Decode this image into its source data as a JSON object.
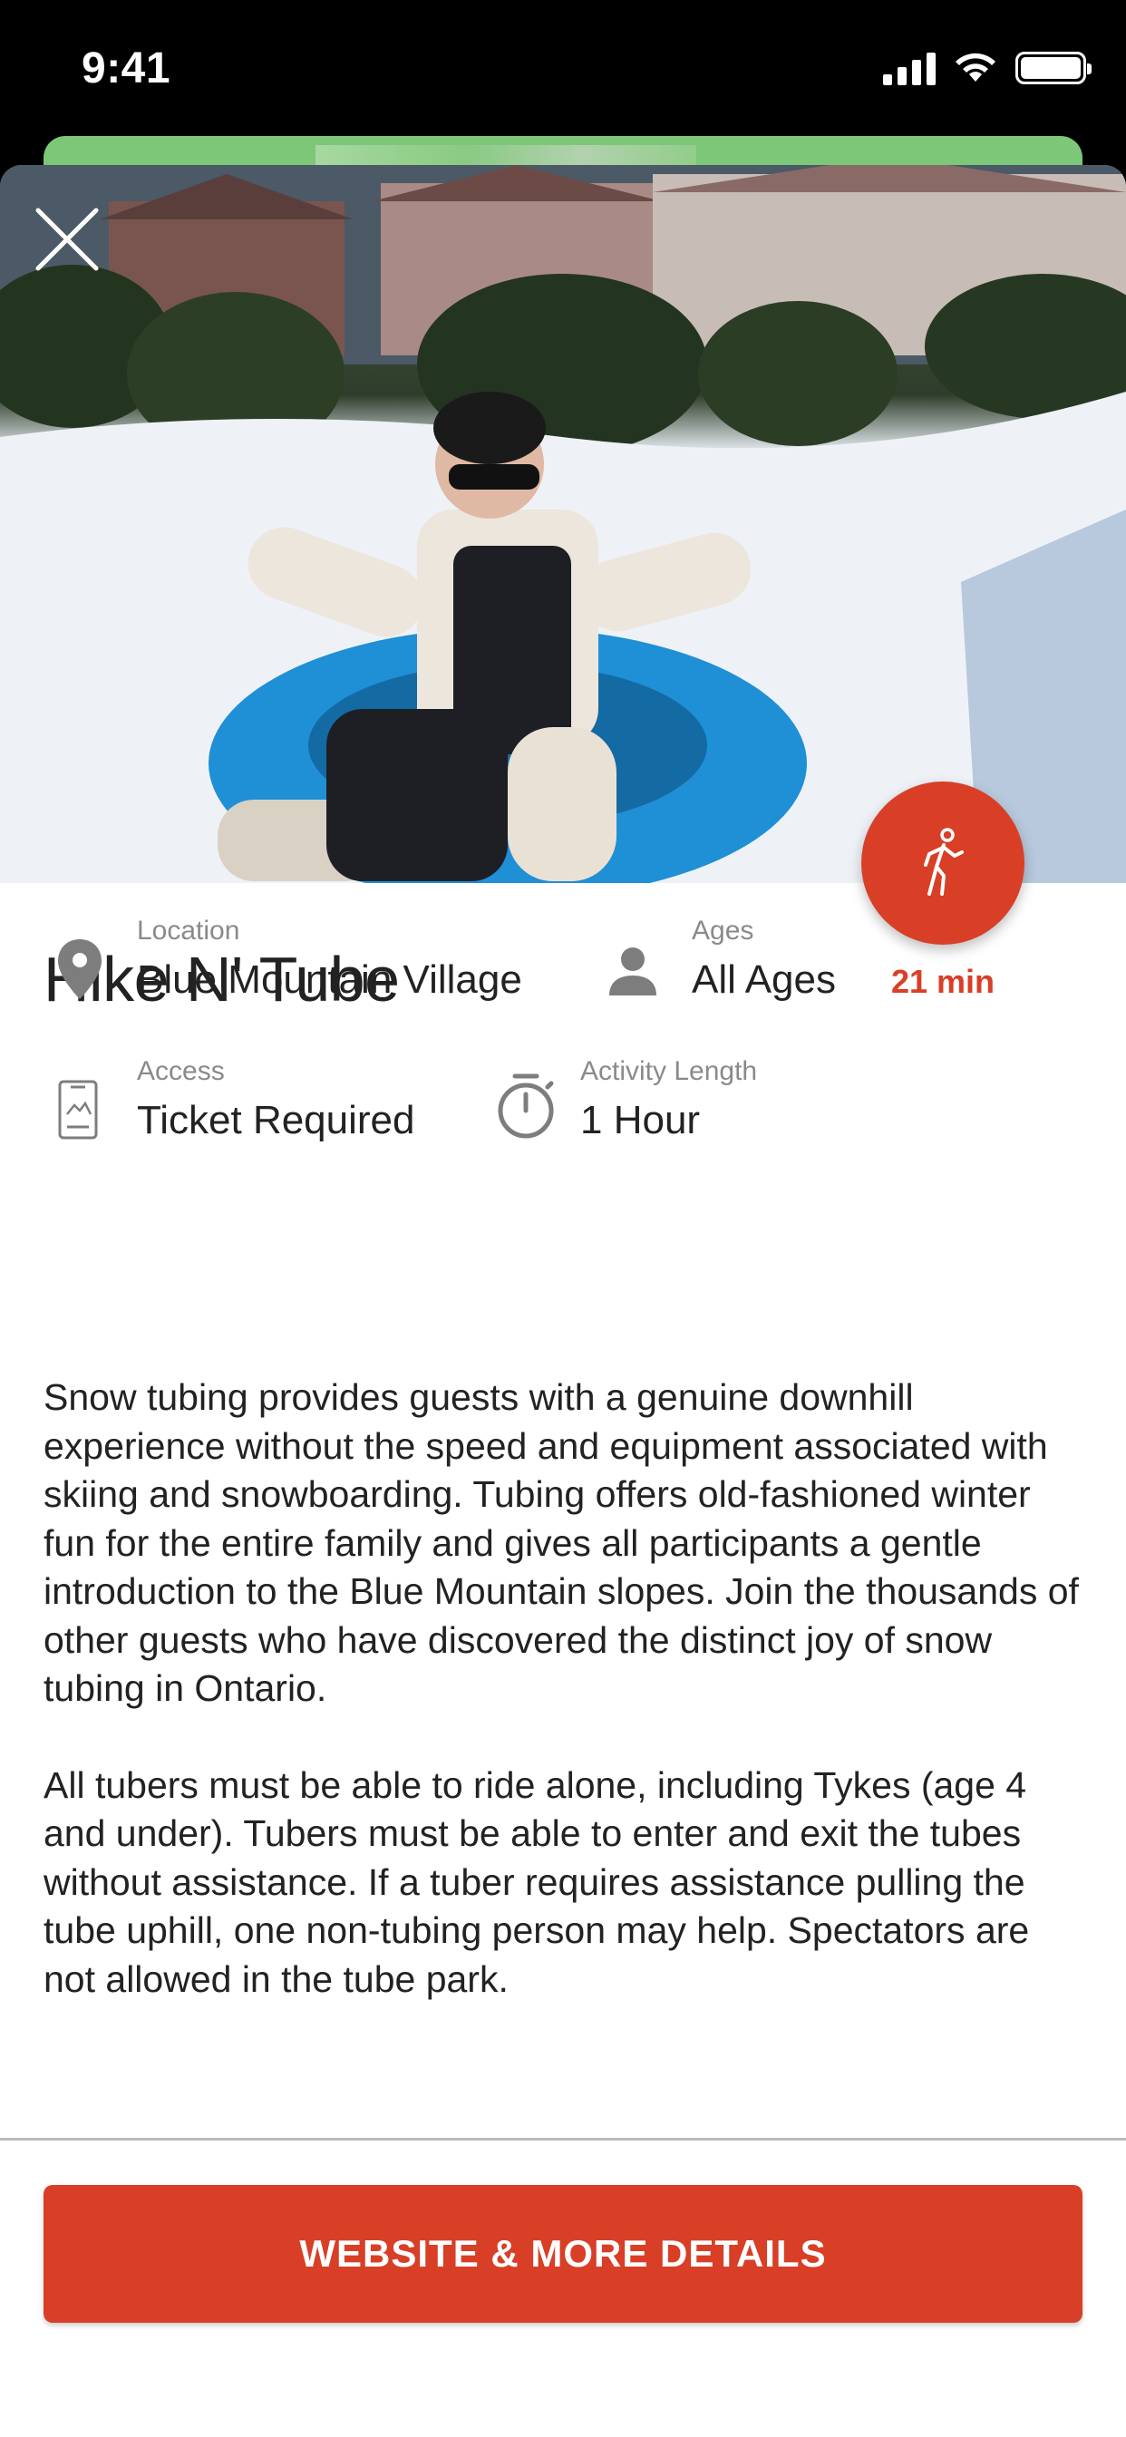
{
  "status_bar": {
    "time": "9:41",
    "icons": [
      "cellular-signal-icon",
      "wifi-icon",
      "battery-icon"
    ]
  },
  "hero": {
    "image_alt": "",
    "close_icon": "close-icon"
  },
  "activity": {
    "title": "Hike N' Tube",
    "walk_icon": "walking-person-icon",
    "walk_time": "21 min",
    "details": {
      "location": {
        "label": "Location",
        "value": "Blue Mountain Village",
        "icon": "location-pin-icon"
      },
      "ages": {
        "label": "Ages",
        "value": "All Ages",
        "icon": "person-icon"
      },
      "access": {
        "label": "Access",
        "value": "Ticket Required",
        "icon": "ticket-icon"
      },
      "length": {
        "label": "Activity Length",
        "value": "1 Hour",
        "icon": "stopwatch-icon"
      }
    },
    "description": [
      "Snow tubing provides guests with a genuine downhill experience without the speed and equipment associated with skiing and snowboarding. Tubing offers old-fashioned winter fun for the entire family and gives all participants a gentle introduction to the Blue Mountain slopes. Join the thousands of other guests who have discovered the distinct joy of snow tubing in Ontario.",
      "All tubers must be able to ride alone, including Tykes (age 4 and under). Tubers must be able to enter and exit the tubes without assistance. If a tuber requires assistance pulling the tube uphill, one non-tubing person may help. Spectators are not allowed in the tube park."
    ]
  },
  "cta": {
    "label": "WEBSITE & MORE DETAILS"
  },
  "colors": {
    "accent": "#d83f26",
    "text": "#222222",
    "muted": "#8a8a8a"
  }
}
